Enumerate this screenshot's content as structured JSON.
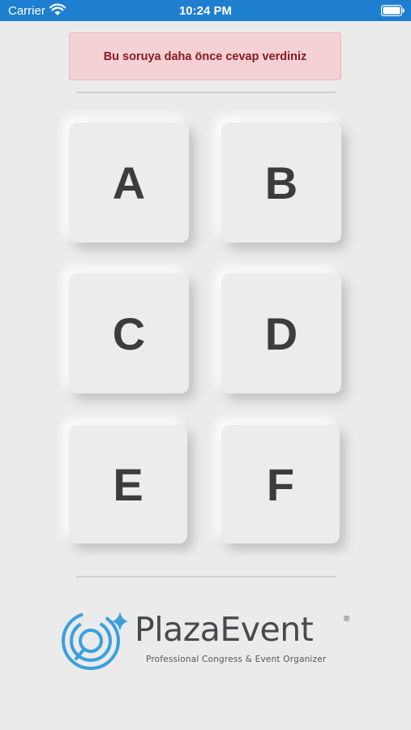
{
  "status_bar": {
    "carrier": "Carrier",
    "time": "10:24 PM"
  },
  "alert": {
    "message": "Bu soruya daha önce cevap verdiniz"
  },
  "options": [
    {
      "label": "A"
    },
    {
      "label": "B"
    },
    {
      "label": "C"
    },
    {
      "label": "D"
    },
    {
      "label": "E"
    },
    {
      "label": "F"
    }
  ],
  "brand": {
    "name": "PlazaEvent",
    "registered": "®",
    "tagline": "Professional Congress & Event Organizer"
  },
  "colors": {
    "status_bar": "#1e7fd0",
    "alert_bg": "#f3d1d4",
    "alert_text": "#8b1a24",
    "logo_blue": "#3aa0dc"
  }
}
